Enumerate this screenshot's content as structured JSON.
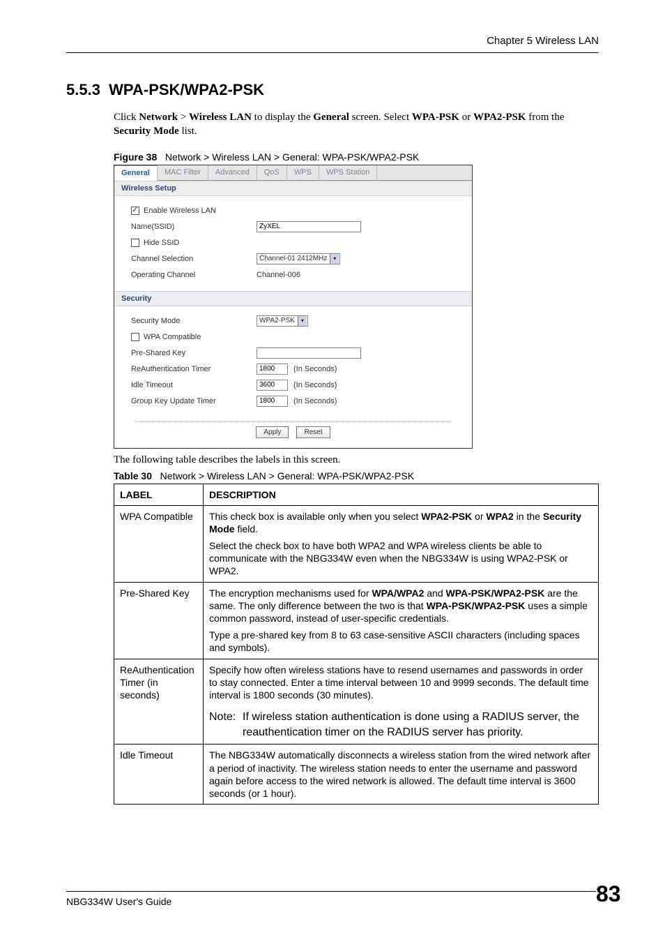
{
  "header": {
    "chapter": "Chapter 5 Wireless LAN"
  },
  "section": {
    "number": "5.5.3",
    "title": "WPA-PSK/WPA2-PSK",
    "intro_prefix": "Click ",
    "intro_nav1": "Network",
    "intro_gt": " > ",
    "intro_nav2": "Wireless LAN",
    "intro_mid1": " to display the ",
    "intro_general": "General",
    "intro_mid2": " screen. Select ",
    "intro_opt1": "WPA-PSK",
    "intro_or": " or ",
    "intro_opt2": "WPA2-PSK",
    "intro_mid3": " from the ",
    "intro_secmode": "Security Mode",
    "intro_end": " list."
  },
  "figure": {
    "label": "Figure 38",
    "title": "Network > Wireless LAN > General: WPA-PSK/WPA2-PSK"
  },
  "screenshot": {
    "tabs": [
      "General",
      "MAC Filter",
      "Advanced",
      "QoS",
      "WPS",
      "WPS Station"
    ],
    "wireless_setup_title": "Wireless Setup",
    "security_title": "Security",
    "labels": {
      "enable": "Enable Wireless LAN",
      "ssid": "Name(SSID)",
      "hide": "Hide SSID",
      "channel_sel": "Channel Selection",
      "op_channel": "Operating Channel",
      "sec_mode": "Security Mode",
      "wpa_compat": "WPA Compatible",
      "psk": "Pre-Shared Key",
      "reauth": "ReAuthentication Timer",
      "idle": "Idle Timeout",
      "gku": "Group Key Update Timer",
      "in_seconds": "(In Seconds)"
    },
    "values": {
      "ssid": "ZyXEL",
      "channel_sel": "Channel-01 2412MHz",
      "op_channel": "Channel-006",
      "sec_mode": "WPA2-PSK",
      "psk": "",
      "reauth": "1800",
      "idle": "3600",
      "gku": "1800"
    },
    "buttons": {
      "apply": "Apply",
      "reset": "Reset"
    }
  },
  "after_figure": "The following table describes the labels in this screen.",
  "table": {
    "label": "Table 30",
    "title": "Network > Wireless LAN > General: WPA-PSK/WPA2-PSK",
    "headers": {
      "label": "LABEL",
      "desc": "DESCRIPTION"
    },
    "rows": {
      "r1": {
        "label": "WPA Compatible",
        "d1a": "This check box is available only when you select ",
        "d1b": "WPA2-PSK",
        "d1c": " or ",
        "d1d": "WPA2",
        "d1e": " in the ",
        "d1f": "Security Mode",
        "d1g": " field.",
        "d2": "Select the check box to have both WPA2 and WPA wireless clients be able to communicate with the NBG334W even when the NBG334W is using WPA2-PSK or WPA2."
      },
      "r2": {
        "label": "Pre-Shared Key",
        "d1a": "The encryption mechanisms used for ",
        "d1b": "WPA/WPA2",
        "d1c": " and ",
        "d1d": "WPA-PSK/WPA2-PSK",
        "d1e": " are the same. The only difference between the two is that ",
        "d1f": "WPA-PSK/WPA2-PSK",
        "d1g": " uses a simple common password, instead of user-specific credentials.",
        "d2": "Type a pre-shared key from 8 to 63 case-sensitive ASCII characters (including spaces and symbols)."
      },
      "r3": {
        "label": "ReAuthentication Timer (in seconds)",
        "d1": "Specify how often wireless stations have to resend usernames and passwords in order to stay connected. Enter a time interval between 10 and 9999 seconds. The default time interval is 1800 seconds (30 minutes).",
        "note_lead": "Note:",
        "note_body": "If wireless station authentication is done using a RADIUS server, the reauthentication timer on the RADIUS server has priority."
      },
      "r4": {
        "label": "Idle Timeout",
        "d1": "The NBG334W automatically disconnects a wireless station from the wired network after a period of inactivity. The wireless station needs to enter the username and password again before access to the wired network is allowed. The default time interval is 3600 seconds (or 1 hour)."
      }
    }
  },
  "footer": {
    "guide": "NBG334W User's Guide",
    "page": "83"
  }
}
